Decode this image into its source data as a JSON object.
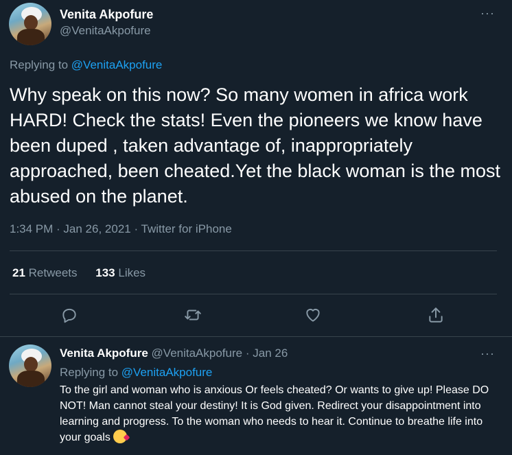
{
  "tweet": {
    "author_name": "Venita Akpofure",
    "author_handle": "@VenitaAkpofure",
    "replying_prefix": "Replying to",
    "replying_to": "@VenitaAkpofure",
    "text": "Why speak on this now? So many women in africa work HARD! Check the stats! Even the pioneers we know have been duped , taken advantage of, inappropriately approached, been cheated.Yet the black woman is the most abused on the planet.",
    "meta": "1:34 PM · Jan 26, 2021 · Twitter for iPhone",
    "retweets_count": "21",
    "retweets_label": "Retweets",
    "likes_count": "133",
    "likes_label": "Likes",
    "more_label": "···"
  },
  "icons": {
    "reply": "reply-icon",
    "retweet": "retweet-icon",
    "like": "heart-icon",
    "share": "share-icon"
  },
  "reply": {
    "author_name": "Venita Akpofure",
    "author_handle": "@VenitaAkpofure",
    "separator": "·",
    "date": "Jan 26",
    "replying_prefix": "Replying to",
    "replying_to": "@VenitaAkpofure",
    "text": "To the girl and woman who is anxious Or feels cheated? Or wants to give up! Please DO NOT! Man cannot steal your destiny! It is God given. Redirect your disappointment into learning and progress. To the woman who needs to hear it. Continue to breathe life into your goals",
    "emoji": "face-blowing-a-kiss",
    "more_label": "···"
  },
  "colors": {
    "background": "#15202b",
    "secondary_text": "#8899a6",
    "link": "#1da1f2",
    "divider": "#38444d"
  }
}
